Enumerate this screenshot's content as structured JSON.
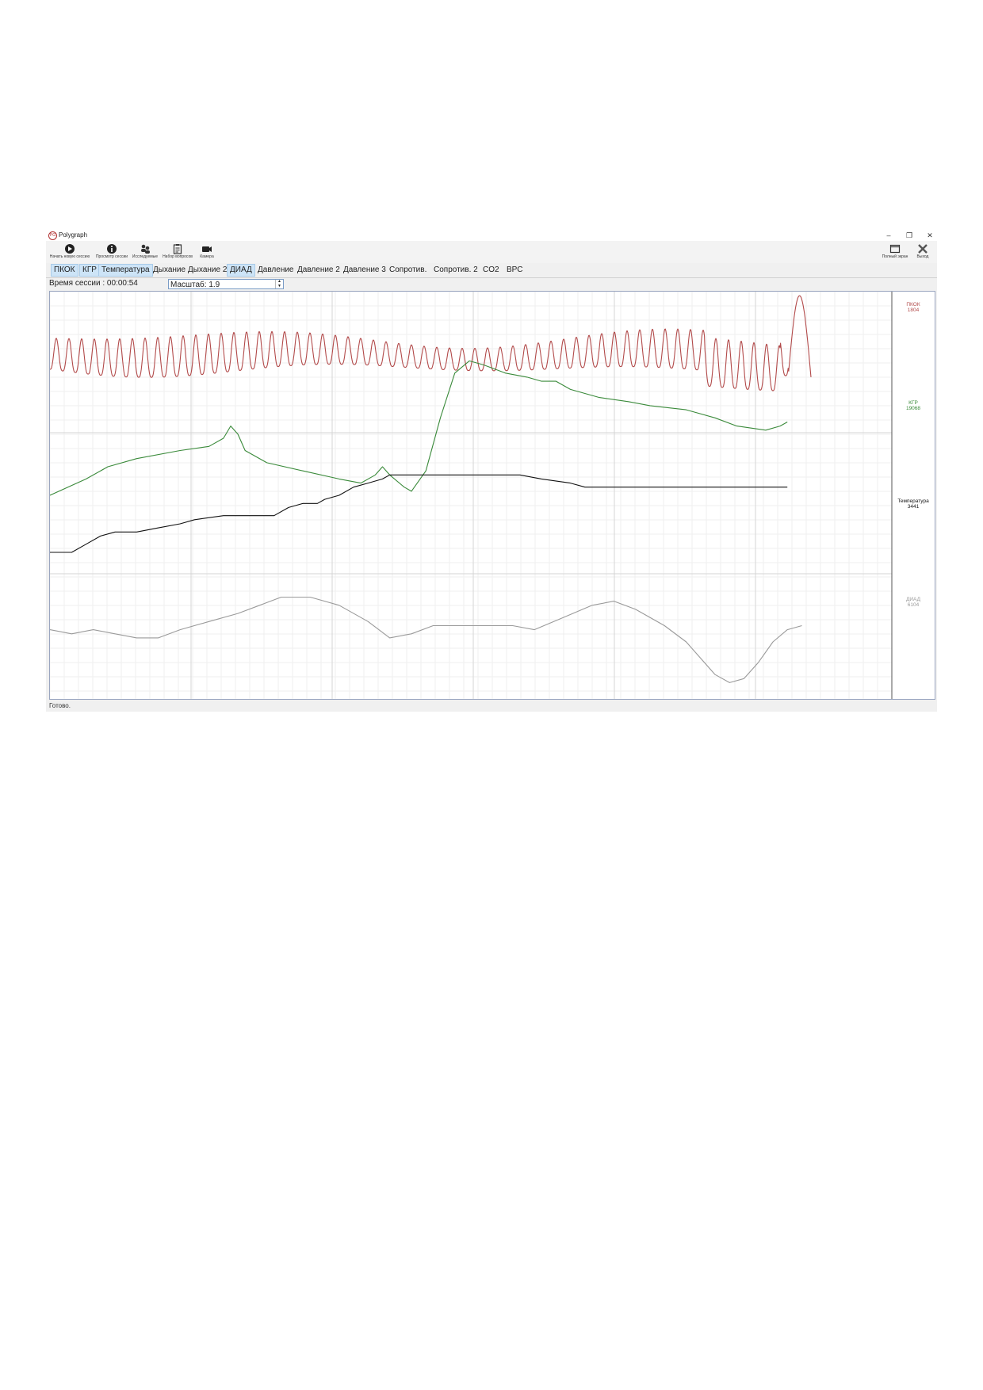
{
  "window": {
    "title": "Polygraph"
  },
  "toolbar": {
    "items": [
      {
        "label": "Начать новую сессию",
        "icon": "play-icon"
      },
      {
        "label": "Просмотр сессии",
        "icon": "info-icon"
      },
      {
        "label": "Исследуемые",
        "icon": "users-icon"
      },
      {
        "label": "Набор вопросов",
        "icon": "clipboard-icon"
      },
      {
        "label": "Камера",
        "icon": "camera-icon"
      }
    ],
    "fullscreen_label": "Полный экран",
    "exit_label": "Выход"
  },
  "tabs": [
    {
      "label": "ПКОК",
      "active": true
    },
    {
      "label": "КГР",
      "active": true
    },
    {
      "label": "Температура",
      "active": true
    },
    {
      "label": "Дыхание",
      "active": false
    },
    {
      "label": "Дыхание 2",
      "active": false
    },
    {
      "label": "ДИАД",
      "active": true
    },
    {
      "label": "Давление",
      "active": false
    },
    {
      "label": "Давление 2",
      "active": false
    },
    {
      "label": "Давление 3",
      "active": false
    },
    {
      "label": "Сопротив.",
      "active": false
    },
    {
      "label": "Сопротив. 2",
      "active": false
    },
    {
      "label": "CO2",
      "active": false
    },
    {
      "label": "ВРС",
      "active": false
    }
  ],
  "session": {
    "time_label": "Время сессии : 00:00:54"
  },
  "scale": {
    "label": "Масштаб: 1.9"
  },
  "status": {
    "text": "Готово."
  },
  "colors": {
    "pkok": "#b24a4a",
    "kgr": "#3a8a3a",
    "temp": "#111111",
    "diad": "#9a9a9a",
    "active_tab": "#cde4f7"
  },
  "chart_data": {
    "type": "line",
    "series": [
      {
        "name": "ПКОК",
        "value_label": "1804",
        "color": "#b24a4a",
        "shape": "oscillation",
        "baseline": 0.16,
        "amplitude": 0.09,
        "cycles": 60,
        "final_spike": true
      },
      {
        "name": "КГР",
        "value_label": "19068",
        "color": "#3a8a3a",
        "points": [
          [
            0,
            0.5
          ],
          [
            0.05,
            0.46
          ],
          [
            0.08,
            0.43
          ],
          [
            0.12,
            0.41
          ],
          [
            0.18,
            0.39
          ],
          [
            0.22,
            0.38
          ],
          [
            0.24,
            0.36
          ],
          [
            0.25,
            0.33
          ],
          [
            0.26,
            0.35
          ],
          [
            0.27,
            0.39
          ],
          [
            0.3,
            0.42
          ],
          [
            0.35,
            0.44
          ],
          [
            0.4,
            0.46
          ],
          [
            0.43,
            0.47
          ],
          [
            0.45,
            0.45
          ],
          [
            0.46,
            0.43
          ],
          [
            0.47,
            0.45
          ],
          [
            0.49,
            0.48
          ],
          [
            0.5,
            0.49
          ],
          [
            0.52,
            0.44
          ],
          [
            0.54,
            0.31
          ],
          [
            0.56,
            0.2
          ],
          [
            0.58,
            0.17
          ],
          [
            0.6,
            0.18
          ],
          [
            0.63,
            0.2
          ],
          [
            0.66,
            0.21
          ],
          [
            0.68,
            0.22
          ],
          [
            0.7,
            0.22
          ],
          [
            0.72,
            0.24
          ],
          [
            0.76,
            0.26
          ],
          [
            0.8,
            0.27
          ],
          [
            0.83,
            0.28
          ],
          [
            0.88,
            0.29
          ],
          [
            0.92,
            0.31
          ],
          [
            0.95,
            0.33
          ],
          [
            0.99,
            0.34
          ],
          [
            1.01,
            0.33
          ],
          [
            1.02,
            0.32
          ]
        ]
      },
      {
        "name": "Температура",
        "value_label": "3441",
        "color": "#111111",
        "points": [
          [
            0,
            0.64
          ],
          [
            0.03,
            0.64
          ],
          [
            0.05,
            0.62
          ],
          [
            0.07,
            0.6
          ],
          [
            0.09,
            0.59
          ],
          [
            0.12,
            0.59
          ],
          [
            0.15,
            0.58
          ],
          [
            0.18,
            0.57
          ],
          [
            0.2,
            0.56
          ],
          [
            0.24,
            0.55
          ],
          [
            0.26,
            0.55
          ],
          [
            0.31,
            0.55
          ],
          [
            0.33,
            0.53
          ],
          [
            0.35,
            0.52
          ],
          [
            0.37,
            0.52
          ],
          [
            0.38,
            0.51
          ],
          [
            0.4,
            0.5
          ],
          [
            0.42,
            0.48
          ],
          [
            0.44,
            0.47
          ],
          [
            0.46,
            0.46
          ],
          [
            0.47,
            0.45
          ],
          [
            0.5,
            0.45
          ],
          [
            0.55,
            0.45
          ],
          [
            0.6,
            0.45
          ],
          [
            0.65,
            0.45
          ],
          [
            0.68,
            0.46
          ],
          [
            0.72,
            0.47
          ],
          [
            0.74,
            0.48
          ],
          [
            0.78,
            0.48
          ],
          [
            0.85,
            0.48
          ],
          [
            0.95,
            0.48
          ],
          [
            1.02,
            0.48
          ]
        ]
      },
      {
        "name": "ДИАД",
        "value_label": "6104",
        "color": "#9a9a9a",
        "points": [
          [
            0,
            0.83
          ],
          [
            0.03,
            0.84
          ],
          [
            0.06,
            0.83
          ],
          [
            0.09,
            0.84
          ],
          [
            0.12,
            0.85
          ],
          [
            0.15,
            0.85
          ],
          [
            0.18,
            0.83
          ],
          [
            0.22,
            0.81
          ],
          [
            0.26,
            0.79
          ],
          [
            0.29,
            0.77
          ],
          [
            0.32,
            0.75
          ],
          [
            0.36,
            0.75
          ],
          [
            0.4,
            0.77
          ],
          [
            0.44,
            0.81
          ],
          [
            0.47,
            0.85
          ],
          [
            0.5,
            0.84
          ],
          [
            0.53,
            0.82
          ],
          [
            0.56,
            0.82
          ],
          [
            0.6,
            0.82
          ],
          [
            0.64,
            0.82
          ],
          [
            0.67,
            0.83
          ],
          [
            0.71,
            0.8
          ],
          [
            0.75,
            0.77
          ],
          [
            0.78,
            0.76
          ],
          [
            0.81,
            0.78
          ],
          [
            0.85,
            0.82
          ],
          [
            0.88,
            0.86
          ],
          [
            0.9,
            0.9
          ],
          [
            0.92,
            0.94
          ],
          [
            0.94,
            0.96
          ],
          [
            0.96,
            0.95
          ],
          [
            0.98,
            0.91
          ],
          [
            1.0,
            0.86
          ],
          [
            1.02,
            0.83
          ],
          [
            1.04,
            0.82
          ]
        ]
      }
    ],
    "grid": true,
    "legend": "right"
  }
}
